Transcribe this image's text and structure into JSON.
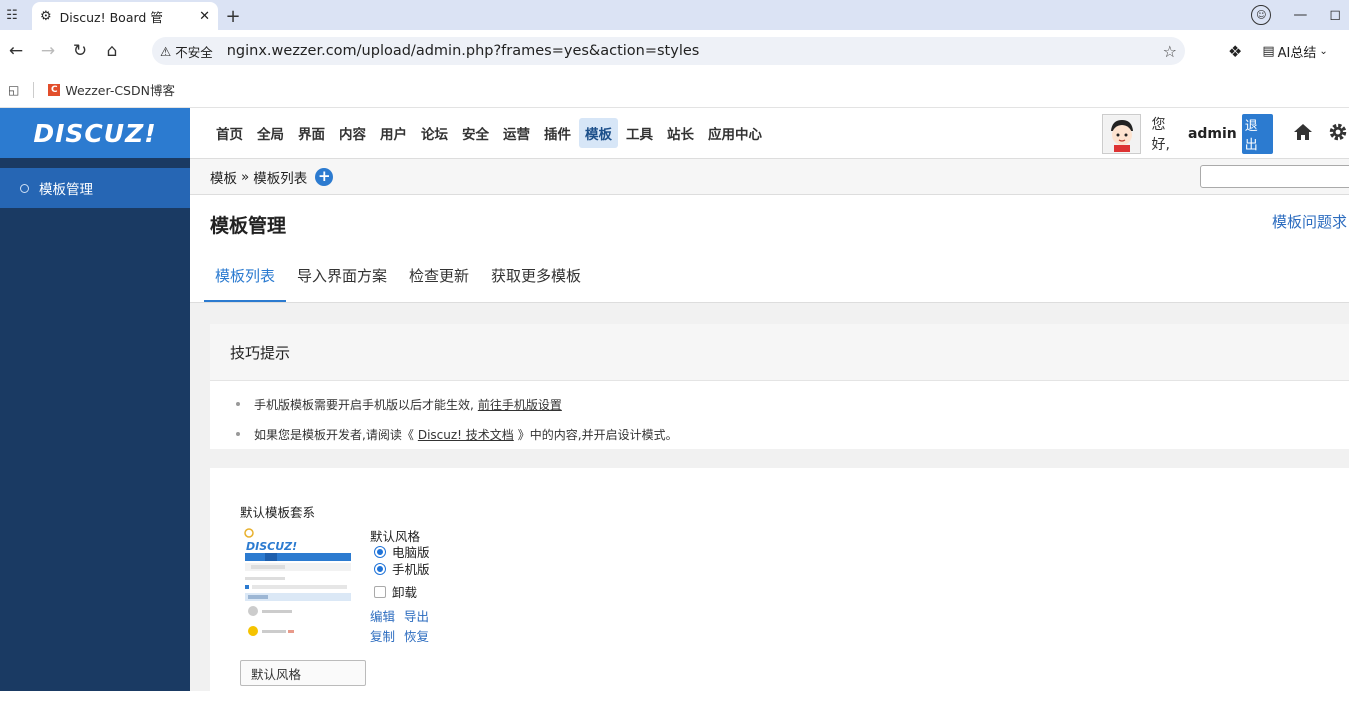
{
  "browser": {
    "tab_title": "Discuz! Board 管",
    "new_tab": "+",
    "insecure_label": "不安全",
    "url": "nginx.wezzer.com/upload/admin.php?frames=yes&action=styles",
    "ai_label": "AI总结",
    "bookmark": "Wezzer-CSDN博客"
  },
  "sidebar": {
    "logo": "DISCUZ!",
    "items": [
      {
        "label": "模板管理"
      }
    ]
  },
  "topnav": {
    "items": [
      "首页",
      "全局",
      "界面",
      "内容",
      "用户",
      "论坛",
      "安全",
      "运营",
      "插件",
      "模板",
      "工具",
      "站长",
      "应用中心"
    ],
    "active": "模板",
    "greeting": "您好,",
    "username": "admin",
    "logout": "退出"
  },
  "breadcrumb": {
    "root": "模板",
    "sep": "»",
    "current": "模板列表",
    "add": "+"
  },
  "main": {
    "title": "模板管理",
    "help_link": "模板问题求",
    "tabs": [
      {
        "label": "模板列表"
      },
      {
        "label": "导入界面方案"
      },
      {
        "label": "检查更新"
      },
      {
        "label": "获取更多模板"
      }
    ]
  },
  "tips": {
    "title": "技巧提示",
    "tip1_text": "手机版模板需要开启手机版以后才能生效,",
    "tip1_link": "前往手机版设置",
    "tip2_pre": "如果您是模板开发者,请阅读《",
    "tip2_link": "Discuz! 技术文档",
    "tip2_post": "》中的内容,并开启设计模式。"
  },
  "template": {
    "set_title": "默认模板套系",
    "style_title": "默认风格",
    "pc": "电脑版",
    "mobile": "手机版",
    "uninstall": "卸载",
    "edit": "编辑",
    "export": "导出",
    "copy": "复制",
    "restore": "恢复",
    "name_value": "默认风格"
  },
  "colors": {
    "accent": "#2c7bd0",
    "sidebar_bg": "#1a3a63",
    "link": "#2c6cbf"
  }
}
